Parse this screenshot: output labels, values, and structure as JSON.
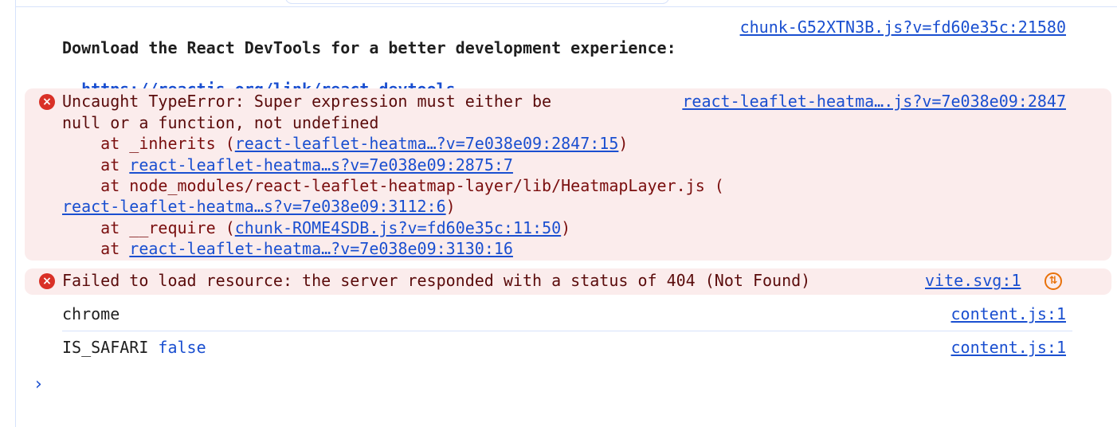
{
  "messages": {
    "info": {
      "source": "chunk-G52XTN3B.js?v=fd60e35c:21580",
      "text_line1": "Download the React DevTools for a better development experience:",
      "link": "https://reactjs.org/link/react-devtools"
    },
    "error1": {
      "source": "react-leaflet-heatma….js?v=7e038e09:2847",
      "message_line1": "Uncaught TypeError: Super expression must either be",
      "message_line2": "null or a function, not undefined",
      "stack": {
        "frame1_prefix": "    at _inherits (",
        "frame1_link": "react-leaflet-heatma…?v=7e038e09:2847:15",
        "frame1_suffix": ")",
        "frame2_prefix": "    at ",
        "frame2_link": "react-leaflet-heatma…s?v=7e038e09:2875:7",
        "frame3_prefix": "    at node_modules/react-leaflet-heatmap-layer/lib/HeatmapLayer.js (",
        "frame3_link": "react-leaflet-heatma…s?v=7e038e09:3112:6",
        "frame3_suffix": ")",
        "frame4_prefix": "    at __require (",
        "frame4_link": "chunk-ROME4SDB.js?v=fd60e35c:11:50",
        "frame4_suffix": ")",
        "frame5_prefix": "    at ",
        "frame5_link": "react-leaflet-heatma…?v=7e038e09:3130:16"
      }
    },
    "error2": {
      "message": "Failed to load resource: the server responded with a status of 404 (Not Found)",
      "source": "vite.svg:1"
    },
    "log1": {
      "text": "chrome",
      "source": "content.js:1"
    },
    "log2": {
      "label": "IS_SAFARI",
      "value": "false",
      "source": "content.js:1"
    }
  },
  "icons": {
    "error": "×",
    "network": "⇅",
    "prompt": "›"
  },
  "colors": {
    "error_bg": "#fbecec",
    "error_icon": "#d93026",
    "error_text": "#7a0e0e",
    "link": "#1a4fd0",
    "network_icon": "#e8710a",
    "divider": "#d6e2fb"
  }
}
